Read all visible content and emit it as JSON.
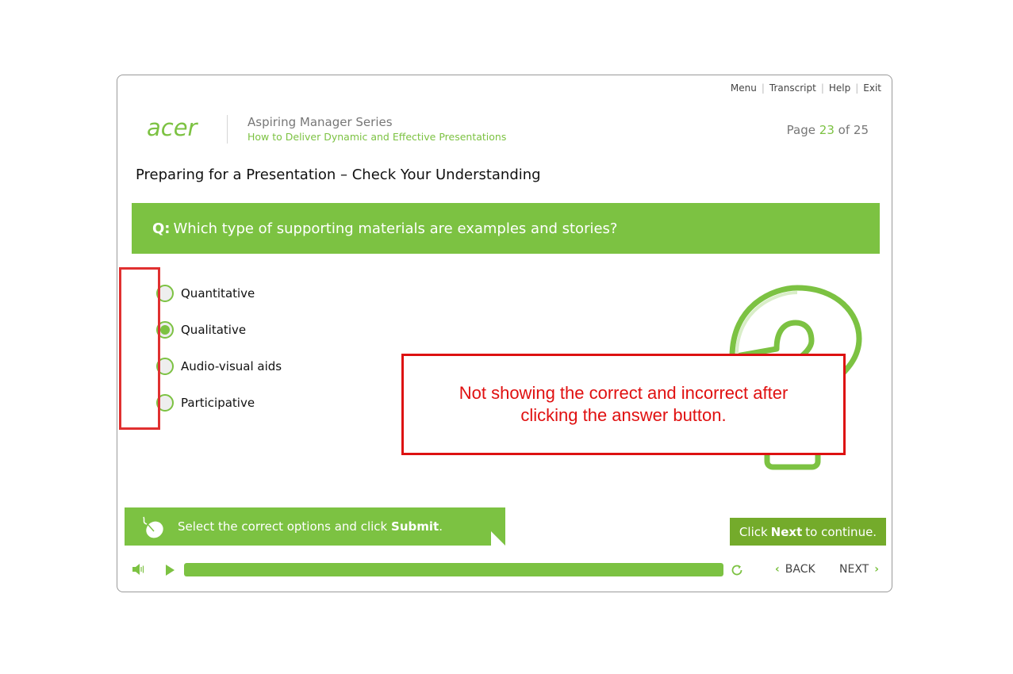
{
  "header": {
    "nav": [
      "Menu",
      "Transcript",
      "Help",
      "Exit"
    ],
    "logo_text": "acer",
    "series": "Aspiring Manager Series",
    "course": "How to Deliver Dynamic and Effective Presentations",
    "page": {
      "prefix": "Page",
      "current": "23",
      "of_word": "of",
      "total": "25"
    }
  },
  "page_title": "Preparing for a Presentation – Check Your Understanding",
  "question": {
    "prefix": "Q:",
    "text": "Which type of supporting materials are examples and stories?"
  },
  "options": [
    {
      "label": "Quantitative",
      "selected": false
    },
    {
      "label": "Qualitative",
      "selected": true
    },
    {
      "label": "Audio-visual aids",
      "selected": false
    },
    {
      "label": "Participative",
      "selected": false
    }
  ],
  "annotation": {
    "text": "Not showing the correct and incorrect after clicking the answer button."
  },
  "instruction": {
    "before": "Select the correct options and click ",
    "bold": "Submit",
    "after": "."
  },
  "continue": {
    "before": "Click ",
    "bold": "Next",
    "after": " to continue."
  },
  "player": {
    "progress": 1.0,
    "back_label": "BACK",
    "next_label": "NEXT"
  },
  "colors": {
    "accent": "#7cc242",
    "annotation_red": "#dd1111"
  }
}
